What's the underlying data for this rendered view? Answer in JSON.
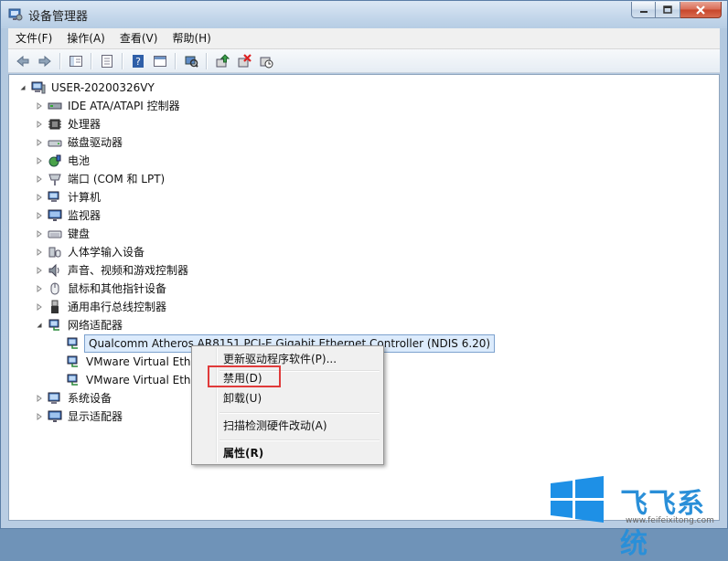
{
  "window": {
    "title": "设备管理器",
    "controls": [
      "minimize-icon",
      "maximize-icon",
      "close-icon"
    ]
  },
  "menubar": {
    "items": [
      {
        "label": "文件(F)"
      },
      {
        "label": "操作(A)"
      },
      {
        "label": "查看(V)"
      },
      {
        "label": "帮助(H)"
      }
    ]
  },
  "toolbar": {
    "buttons": [
      "back-icon",
      "forward-icon",
      "show-hide-tree-icon",
      "properties-icon",
      "help-icon",
      "view-icon",
      "scan-hardware-icon",
      "update-driver-icon",
      "uninstall-icon",
      "disable-icon"
    ]
  },
  "tree": {
    "root": {
      "label": "USER-20200326VY"
    },
    "categories": [
      {
        "label": "IDE ATA/ATAPI 控制器",
        "icon": "ide-controller-icon"
      },
      {
        "label": "处理器",
        "icon": "processor-icon"
      },
      {
        "label": "磁盘驱动器",
        "icon": "disk-drive-icon"
      },
      {
        "label": "电池",
        "icon": "battery-icon"
      },
      {
        "label": "端口 (COM 和 LPT)",
        "icon": "port-icon"
      },
      {
        "label": "计算机",
        "icon": "computer-icon"
      },
      {
        "label": "监视器",
        "icon": "monitor-icon"
      },
      {
        "label": "键盘",
        "icon": "keyboard-icon"
      },
      {
        "label": "人体学输入设备",
        "icon": "hid-icon"
      },
      {
        "label": "声音、视频和游戏控制器",
        "icon": "sound-icon"
      },
      {
        "label": "鼠标和其他指针设备",
        "icon": "mouse-icon"
      },
      {
        "label": "通用串行总线控制器",
        "icon": "usb-icon"
      },
      {
        "label": "网络适配器",
        "icon": "network-adapter-icon"
      }
    ],
    "network_children": [
      {
        "label": "Qualcomm Atheros AR8151 PCI-E Gigabit Ethernet Controller (NDIS 6.20)"
      },
      {
        "label": "VMware Virtual Ethe"
      },
      {
        "label": "VMware Virtual Ethe"
      }
    ],
    "after": [
      {
        "label": "系统设备",
        "icon": "system-device-icon"
      },
      {
        "label": "显示适配器",
        "icon": "display-adapter-icon"
      }
    ]
  },
  "context_menu": {
    "items": [
      {
        "label": "更新驱动程序软件(P)..."
      },
      {
        "label": "禁用(D)"
      },
      {
        "label": "卸载(U)"
      },
      {
        "label": "扫描检测硬件改动(A)"
      },
      {
        "label": "属性(R)"
      }
    ]
  },
  "watermark": {
    "text": "飞飞系统",
    "url": "www.feifeixitong.com"
  },
  "colors": {
    "accent": "#3399ff",
    "highlight_box": "#e03a3a",
    "watermark": "#2a8fd8"
  }
}
